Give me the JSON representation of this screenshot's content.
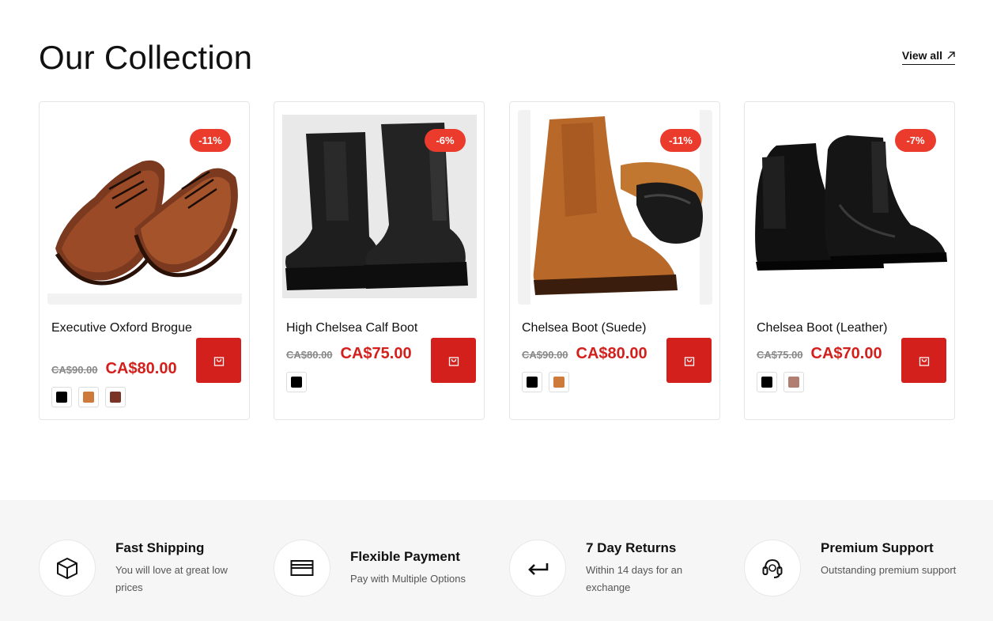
{
  "section": {
    "title": "Our Collection",
    "view_all": "View all"
  },
  "products": [
    {
      "name": "Executive Oxford Brogue",
      "discount": "-11%",
      "old_price": "CA$90.00",
      "new_price": "CA$80.00",
      "image": "brown-oxford-brogue-shoes",
      "swatches": [
        "#000000",
        "#cd7a3b",
        "#7a3425"
      ]
    },
    {
      "name": "High Chelsea Calf Boot",
      "discount": "-6%",
      "old_price": "CA$80.00",
      "new_price": "CA$75.00",
      "image": "black-chunky-chelsea-boots",
      "swatches": [
        "#000000"
      ]
    },
    {
      "name": "Chelsea Boot (Suede)",
      "discount": "-11%",
      "old_price": "CA$90.00",
      "new_price": "CA$80.00",
      "image": "tan-suede-chelsea-boots",
      "swatches": [
        "#000000",
        "#cd7a3b"
      ]
    },
    {
      "name": "Chelsea Boot (Leather)",
      "discount": "-7%",
      "old_price": "CA$75.00",
      "new_price": "CA$70.00",
      "image": "black-leather-chelsea-boots",
      "swatches": [
        "#000000",
        "#b07f72"
      ]
    }
  ],
  "features": [
    {
      "icon": "box-icon",
      "title": "Fast Shipping",
      "desc": "You will love at great low prices"
    },
    {
      "icon": "credit-card-icon",
      "title": "Flexible Payment",
      "desc": "Pay with Multiple Options"
    },
    {
      "icon": "return-arrow-icon",
      "title": "7 Day Returns",
      "desc": "Within 14 days for an exchange"
    },
    {
      "icon": "headset-icon",
      "title": "Premium Support",
      "desc": "Outstanding premium support"
    }
  ],
  "colors": {
    "accent": "#d3201c",
    "badge": "#ea3b2d",
    "old_price": "#888888"
  }
}
